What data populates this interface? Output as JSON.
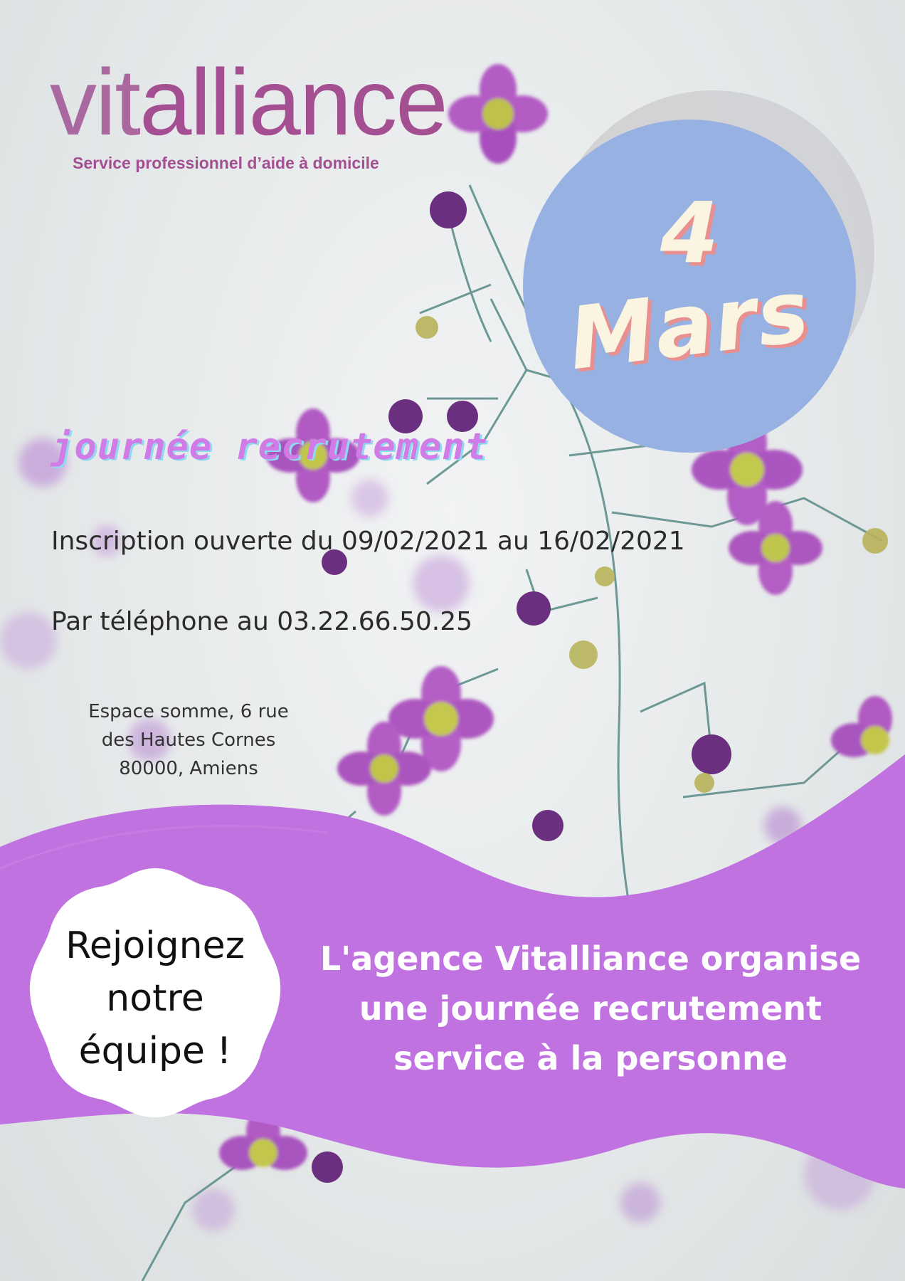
{
  "logo": {
    "light_text": "vit",
    "bold_text": "alliance",
    "tagline": "Service professionnel d’aide à domicile"
  },
  "date": {
    "day": "4",
    "month": "Mars"
  },
  "event_title": "journée recrutement",
  "registration": "Inscription ouverte du 09/02/2021 au 16/02/2021",
  "phone": "Par téléphone au 03.22.66.50.25",
  "address": {
    "line1": "Espace somme, 6 rue",
    "line2": "des Hautes Cornes",
    "line3": "80000, Amiens"
  },
  "badge": {
    "line1": "Rejoignez",
    "line2": "notre",
    "line3": "équipe !"
  },
  "message": {
    "line1": "L'agence Vitalliance organise",
    "line2": "une journée recrutement",
    "line3": "service à la personne"
  },
  "colors": {
    "brand": "#a34f92",
    "wave": "#bf72e0",
    "date_circle": "#97b2e2",
    "date_text": "#fbf4e0",
    "date_shadow": "#e88f8f"
  }
}
